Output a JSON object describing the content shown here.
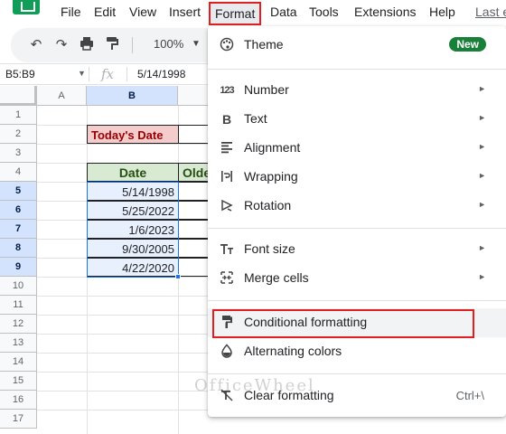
{
  "menubar": {
    "items": [
      "File",
      "Edit",
      "View",
      "Insert",
      "Format",
      "Data",
      "Tools",
      "Extensions",
      "Help",
      "Last e"
    ]
  },
  "toolbar": {
    "zoom": "100%"
  },
  "formula_bar": {
    "name_box": "B5:B9",
    "formula": "5/14/1998"
  },
  "columns": [
    "A",
    "B"
  ],
  "rows": [
    "1",
    "2",
    "3",
    "4",
    "5",
    "6",
    "7",
    "8",
    "9",
    "10",
    "11",
    "12",
    "13",
    "14",
    "15",
    "16",
    "17"
  ],
  "sheet": {
    "today_label": "Today's Date",
    "header_date": "Date",
    "header_older": "Olde",
    "dates": [
      "5/14/1998",
      "5/25/2022",
      "1/6/2023",
      "9/30/2005",
      "4/22/2020"
    ]
  },
  "format_menu": {
    "theme": "Theme",
    "new_badge": "New",
    "number": "Number",
    "text": "Text",
    "alignment": "Alignment",
    "wrapping": "Wrapping",
    "rotation": "Rotation",
    "font_size": "Font size",
    "merge_cells": "Merge cells",
    "conditional_formatting": "Conditional formatting",
    "alternating_colors": "Alternating colors",
    "clear_formatting": "Clear formatting",
    "clear_shortcut": "Ctrl+\\"
  },
  "icons": {
    "number": "123",
    "text": "B"
  },
  "watermark": "OfficeWheel",
  "colors": {
    "highlight_red": "#e02020",
    "sheets_green": "#0f9d58",
    "selection_blue": "#1a73e8"
  }
}
